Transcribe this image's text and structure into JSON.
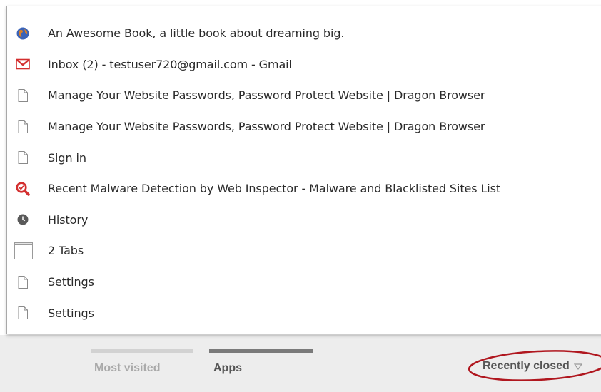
{
  "menu": {
    "items": [
      {
        "icon": "globe-icon",
        "label": "An Awesome Book, a little book about dreaming big."
      },
      {
        "icon": "gmail-icon",
        "label": "Inbox (2) - testuser720@gmail.com - Gmail"
      },
      {
        "icon": "page-icon",
        "label": "Manage Your Website Passwords, Password Protect Website | Dragon Browser"
      },
      {
        "icon": "page-icon",
        "label": "Manage Your Website Passwords, Password Protect Website | Dragon Browser"
      },
      {
        "icon": "page-icon",
        "label": "Sign in"
      },
      {
        "icon": "web-inspector-icon",
        "label": "Recent Malware Detection by Web Inspector - Malware and Blacklisted Sites List"
      },
      {
        "icon": "clock-icon",
        "label": "History"
      },
      {
        "icon": "window-icon",
        "label": "2 Tabs"
      },
      {
        "icon": "page-icon",
        "label": "Settings"
      },
      {
        "icon": "page-icon",
        "label": "Settings"
      }
    ]
  },
  "footer": {
    "most_visited_label": "Most visited",
    "apps_label": "Apps",
    "recently_closed_label": "Recently closed",
    "recently_closed_icon": "chevron-down-icon",
    "highlight_color": "#b0171f"
  }
}
